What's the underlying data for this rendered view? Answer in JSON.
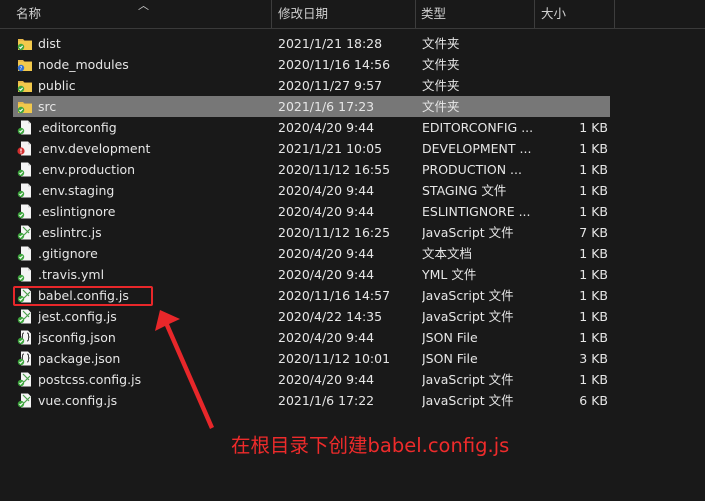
{
  "columns": {
    "name": "名称",
    "date": "修改日期",
    "type": "类型",
    "size": "大小"
  },
  "rows": [
    {
      "name": "dist",
      "date": "2021/1/21 18:28",
      "type": "文件夹",
      "size": "",
      "icon": "folder-icon",
      "selected": false
    },
    {
      "name": "node_modules",
      "date": "2020/11/16 14:56",
      "type": "文件夹",
      "size": "",
      "icon": "folder-sync-icon",
      "selected": false
    },
    {
      "name": "public",
      "date": "2020/11/27 9:57",
      "type": "文件夹",
      "size": "",
      "icon": "folder-icon",
      "selected": false
    },
    {
      "name": "src",
      "date": "2021/1/6 17:23",
      "type": "文件夹",
      "size": "",
      "icon": "folder-icon",
      "selected": true
    },
    {
      "name": ".editorconfig",
      "date": "2020/4/20 9:44",
      "type": "EDITORCONFIG ...",
      "size": "1 KB",
      "icon": "file-synced-icon",
      "selected": false
    },
    {
      "name": ".env.development",
      "date": "2021/1/21 10:05",
      "type": "DEVELOPMENT ...",
      "size": "1 KB",
      "icon": "file-error-icon",
      "selected": false
    },
    {
      "name": ".env.production",
      "date": "2020/11/12 16:55",
      "type": "PRODUCTION ...",
      "size": "1 KB",
      "icon": "file-synced-icon",
      "selected": false
    },
    {
      "name": ".env.staging",
      "date": "2020/4/20 9:44",
      "type": "STAGING 文件",
      "size": "1 KB",
      "icon": "file-synced-icon",
      "selected": false
    },
    {
      "name": ".eslintignore",
      "date": "2020/4/20 9:44",
      "type": "ESLINTIGNORE ...",
      "size": "1 KB",
      "icon": "file-synced-icon",
      "selected": false
    },
    {
      "name": ".eslintrc.js",
      "date": "2020/11/12 16:25",
      "type": "JavaScript 文件",
      "size": "7 KB",
      "icon": "js-file-synced-icon",
      "selected": false
    },
    {
      "name": ".gitignore",
      "date": "2020/4/20 9:44",
      "type": "文本文档",
      "size": "1 KB",
      "icon": "file-synced-icon",
      "selected": false
    },
    {
      "name": ".travis.yml",
      "date": "2020/4/20 9:44",
      "type": "YML 文件",
      "size": "1 KB",
      "icon": "file-synced-icon",
      "selected": false
    },
    {
      "name": "babel.config.js",
      "date": "2020/11/16 14:57",
      "type": "JavaScript 文件",
      "size": "1 KB",
      "icon": "js-file-synced-icon",
      "selected": false
    },
    {
      "name": "jest.config.js",
      "date": "2020/4/22 14:35",
      "type": "JavaScript 文件",
      "size": "1 KB",
      "icon": "js-file-synced-icon",
      "selected": false
    },
    {
      "name": "jsconfig.json",
      "date": "2020/4/20 9:44",
      "type": "JSON File",
      "size": "1 KB",
      "icon": "json-file-synced-icon",
      "selected": false
    },
    {
      "name": "package.json",
      "date": "2020/11/12 10:01",
      "type": "JSON File",
      "size": "3 KB",
      "icon": "json-file-synced-icon",
      "selected": false
    },
    {
      "name": "postcss.config.js",
      "date": "2020/4/20 9:44",
      "type": "JavaScript 文件",
      "size": "1 KB",
      "icon": "js-file-synced-icon",
      "selected": false
    },
    {
      "name": "vue.config.js",
      "date": "2021/1/6 17:22",
      "type": "JavaScript 文件",
      "size": "6 KB",
      "icon": "js-file-synced-icon",
      "selected": false
    }
  ],
  "annotation": {
    "caption": "在根目录下创建babel.config.js",
    "color": "#e8272a"
  },
  "colors": {
    "background": "#191919",
    "selected": "#777777",
    "sync_green": "#3ea53e",
    "error_red": "#d32f2f"
  }
}
